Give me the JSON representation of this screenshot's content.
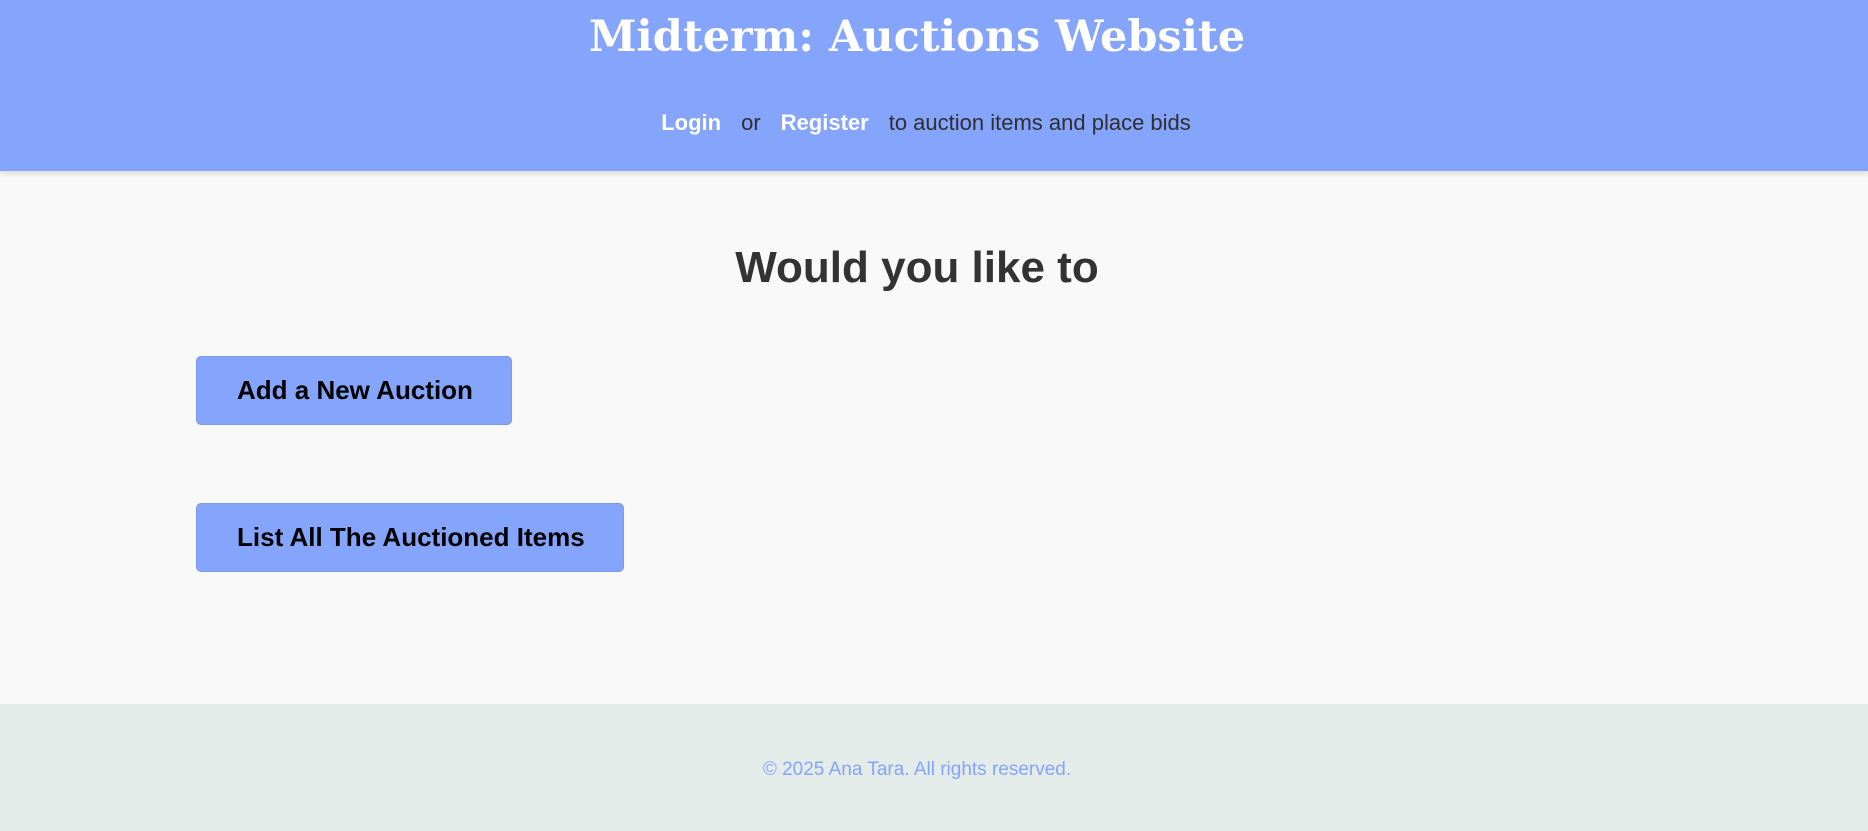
{
  "header": {
    "title": "Midterm: Auctions Website",
    "login_label": "Login",
    "or_text": "or",
    "register_label": "Register",
    "auth_suffix": "to auction items and place bids"
  },
  "main": {
    "heading": "Would you like to",
    "add_auction_label": "Add a New Auction",
    "list_items_label": "List All The Auctioned Items"
  },
  "footer": {
    "copyright": "© 2025 Ana Tara. All rights reserved."
  },
  "colors": {
    "accent": "#85a4fc",
    "page_background": "#f9f9f9",
    "footer_background": "#e3ece9",
    "heading_text": "#333333"
  }
}
